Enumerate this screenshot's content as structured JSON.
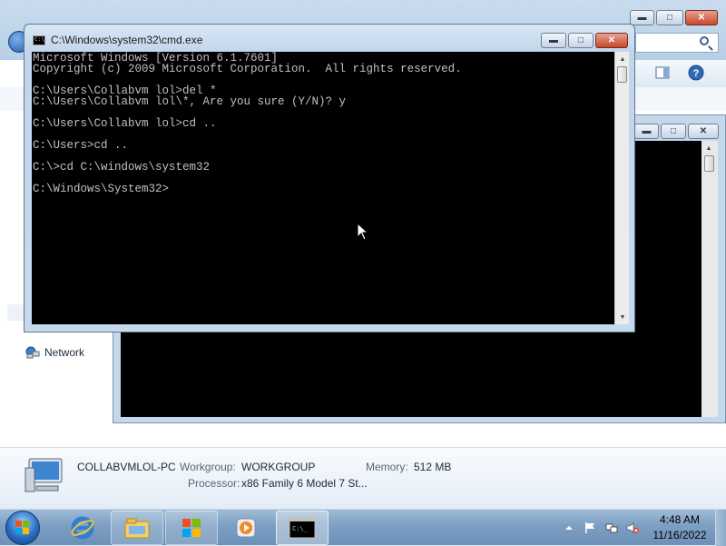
{
  "explorer": {
    "nav_items": [
      {
        "label": "Network",
        "icon": "network-icon"
      }
    ],
    "details": {
      "computer_name": "COLLABVMLOL-PC",
      "workgroup_label": "Workgroup:",
      "workgroup_value": "WORKGROUP",
      "memory_label": "Memory:",
      "memory_value": "512 MB",
      "processor_label": "Processor:",
      "processor_value": "x86 Family 6 Model 7 St..."
    }
  },
  "console_window": {
    "title": "C:\\Windows\\system32\\cmd.exe",
    "lines": [
      "Microsoft Windows [Version 6.1.7601]",
      "Copyright (c) 2009 Microsoft Corporation.  All rights reserved.",
      "",
      "C:\\Users\\Collabvm lol>del *",
      "C:\\Users\\Collabvm lol\\*, Are you sure (Y/N)? y",
      "",
      "C:\\Users\\Collabvm lol>cd ..",
      "",
      "C:\\Users>cd ..",
      "",
      "C:\\>cd C:\\windows\\system32",
      "",
      "C:\\Windows\\System32>"
    ]
  },
  "window_buttons": {
    "minimize": "▬",
    "maximize": "□",
    "close": "✕"
  },
  "taskbar": {
    "pinned": [
      "internet-explorer-icon",
      "windows-explorer-icon",
      "windows-media-player-icon",
      "media-player-icon",
      "command-prompt-icon"
    ],
    "tray_icons": [
      "show-hidden-icons",
      "action-center-flag-icon",
      "network-icon",
      "volume-muted-icon"
    ],
    "clock": {
      "time": "4:48 AM",
      "date": "11/16/2022"
    }
  },
  "colors": {
    "console_background": "#000000",
    "console_text": "#c0c0c0",
    "taskbar": "#7d9fc3",
    "close_button": "#c8472e"
  }
}
